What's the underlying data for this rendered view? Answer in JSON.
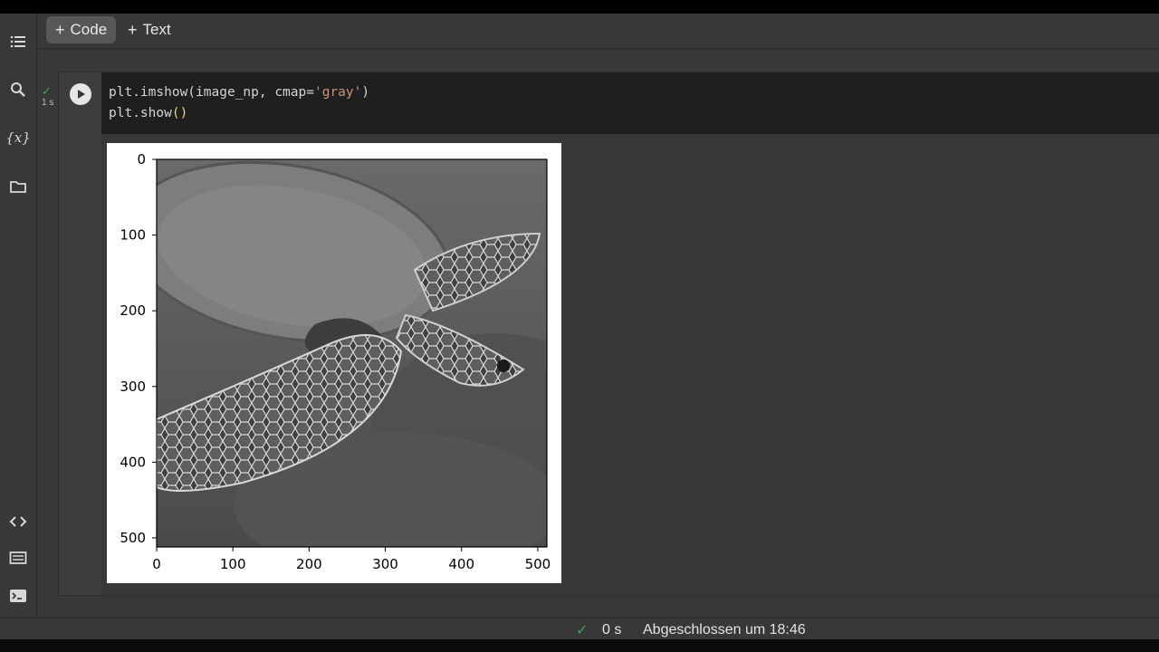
{
  "toolbar": {
    "code_label": "Code",
    "text_label": "Text"
  },
  "sidebar": {
    "icons": [
      "menu-icon",
      "search-icon",
      "variables-icon",
      "folder-icon",
      "code-snippets-icon",
      "command-palette-icon",
      "terminal-icon"
    ],
    "variables_glyph": "{x}"
  },
  "cell": {
    "status_time": "1 s",
    "code_lines": [
      {
        "pre": "plt.imshow(image_np, cmap=",
        "str": "'gray'",
        "post": ")"
      },
      {
        "pre": "plt.show",
        "paren": "()"
      }
    ]
  },
  "chart_data": {
    "type": "image",
    "x_ticks": [
      "0",
      "100",
      "200",
      "300",
      "400",
      "500"
    ],
    "y_ticks": [
      "0",
      "100",
      "200",
      "300",
      "400",
      "500"
    ],
    "xlim": [
      0,
      512
    ],
    "ylim": [
      512,
      0
    ],
    "cmap": "gray"
  },
  "statusbar": {
    "check": "✓",
    "duration": "0 s",
    "message": "Abgeschlossen um 18:46"
  },
  "colors": {
    "success": "#34a853",
    "code_bg": "#1f1f1f",
    "string": "#ce9178"
  }
}
